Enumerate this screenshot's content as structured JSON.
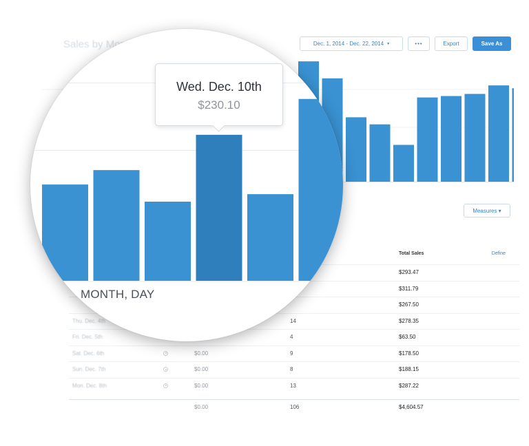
{
  "report": {
    "title": "Sales by Month"
  },
  "toolbar": {
    "date_range": "Dec. 1, 2014 - Dec. 22, 2014",
    "date_caret": "▾",
    "more_label": "•••",
    "export_label": "Export",
    "save_label": "Save As"
  },
  "measures_label": "Measures ▾",
  "table": {
    "columns": {
      "sales": "Total Sales",
      "define": "Define"
    },
    "rows": [
      {
        "date": "",
        "amount": "",
        "orders": "",
        "sales": "$293.47"
      },
      {
        "date": "",
        "amount": "",
        "orders": "",
        "sales": "$311.79"
      },
      {
        "date": "",
        "amount": "",
        "orders": "",
        "sales": "$267.50"
      },
      {
        "date": "Thu. Dec. 4th",
        "amount": "",
        "orders": "14",
        "sales": "$278.35"
      },
      {
        "date": "Fri. Dec. 5th",
        "amount": "",
        "orders": "4",
        "sales": "$63.50"
      },
      {
        "date": "Sat. Dec. 6th",
        "amount": "$0.00",
        "orders": "9",
        "sales": "$178.50"
      },
      {
        "date": "Sun. Dec. 7th",
        "amount": "$0.00",
        "orders": "8",
        "sales": "$188.15"
      },
      {
        "date": "Mon. Dec. 8th",
        "amount": "$0.00",
        "orders": "13",
        "sales": "$287.22"
      }
    ],
    "total": {
      "amount": "$0.00",
      "orders": "106",
      "sales": "$4,604.57"
    }
  },
  "magnifier": {
    "axis_label": "MONTH, DAY",
    "tooltip_title": "Wed. Dec. 10th",
    "tooltip_value": "$230.10"
  },
  "colors": {
    "bar": "#3a92d2",
    "bar_highlight": "#2f7fbd",
    "accent": "#3c84c5"
  },
  "chart_data": {
    "type": "bar",
    "series_values_zoomed": [
      180,
      207,
      148,
      273,
      162,
      340
    ],
    "series_values_background": [
      340,
      292,
      182,
      162,
      104,
      238,
      242,
      248,
      272,
      264
    ],
    "highlight_index": 3,
    "ylim": [
      0,
      350
    ],
    "grid": true
  }
}
